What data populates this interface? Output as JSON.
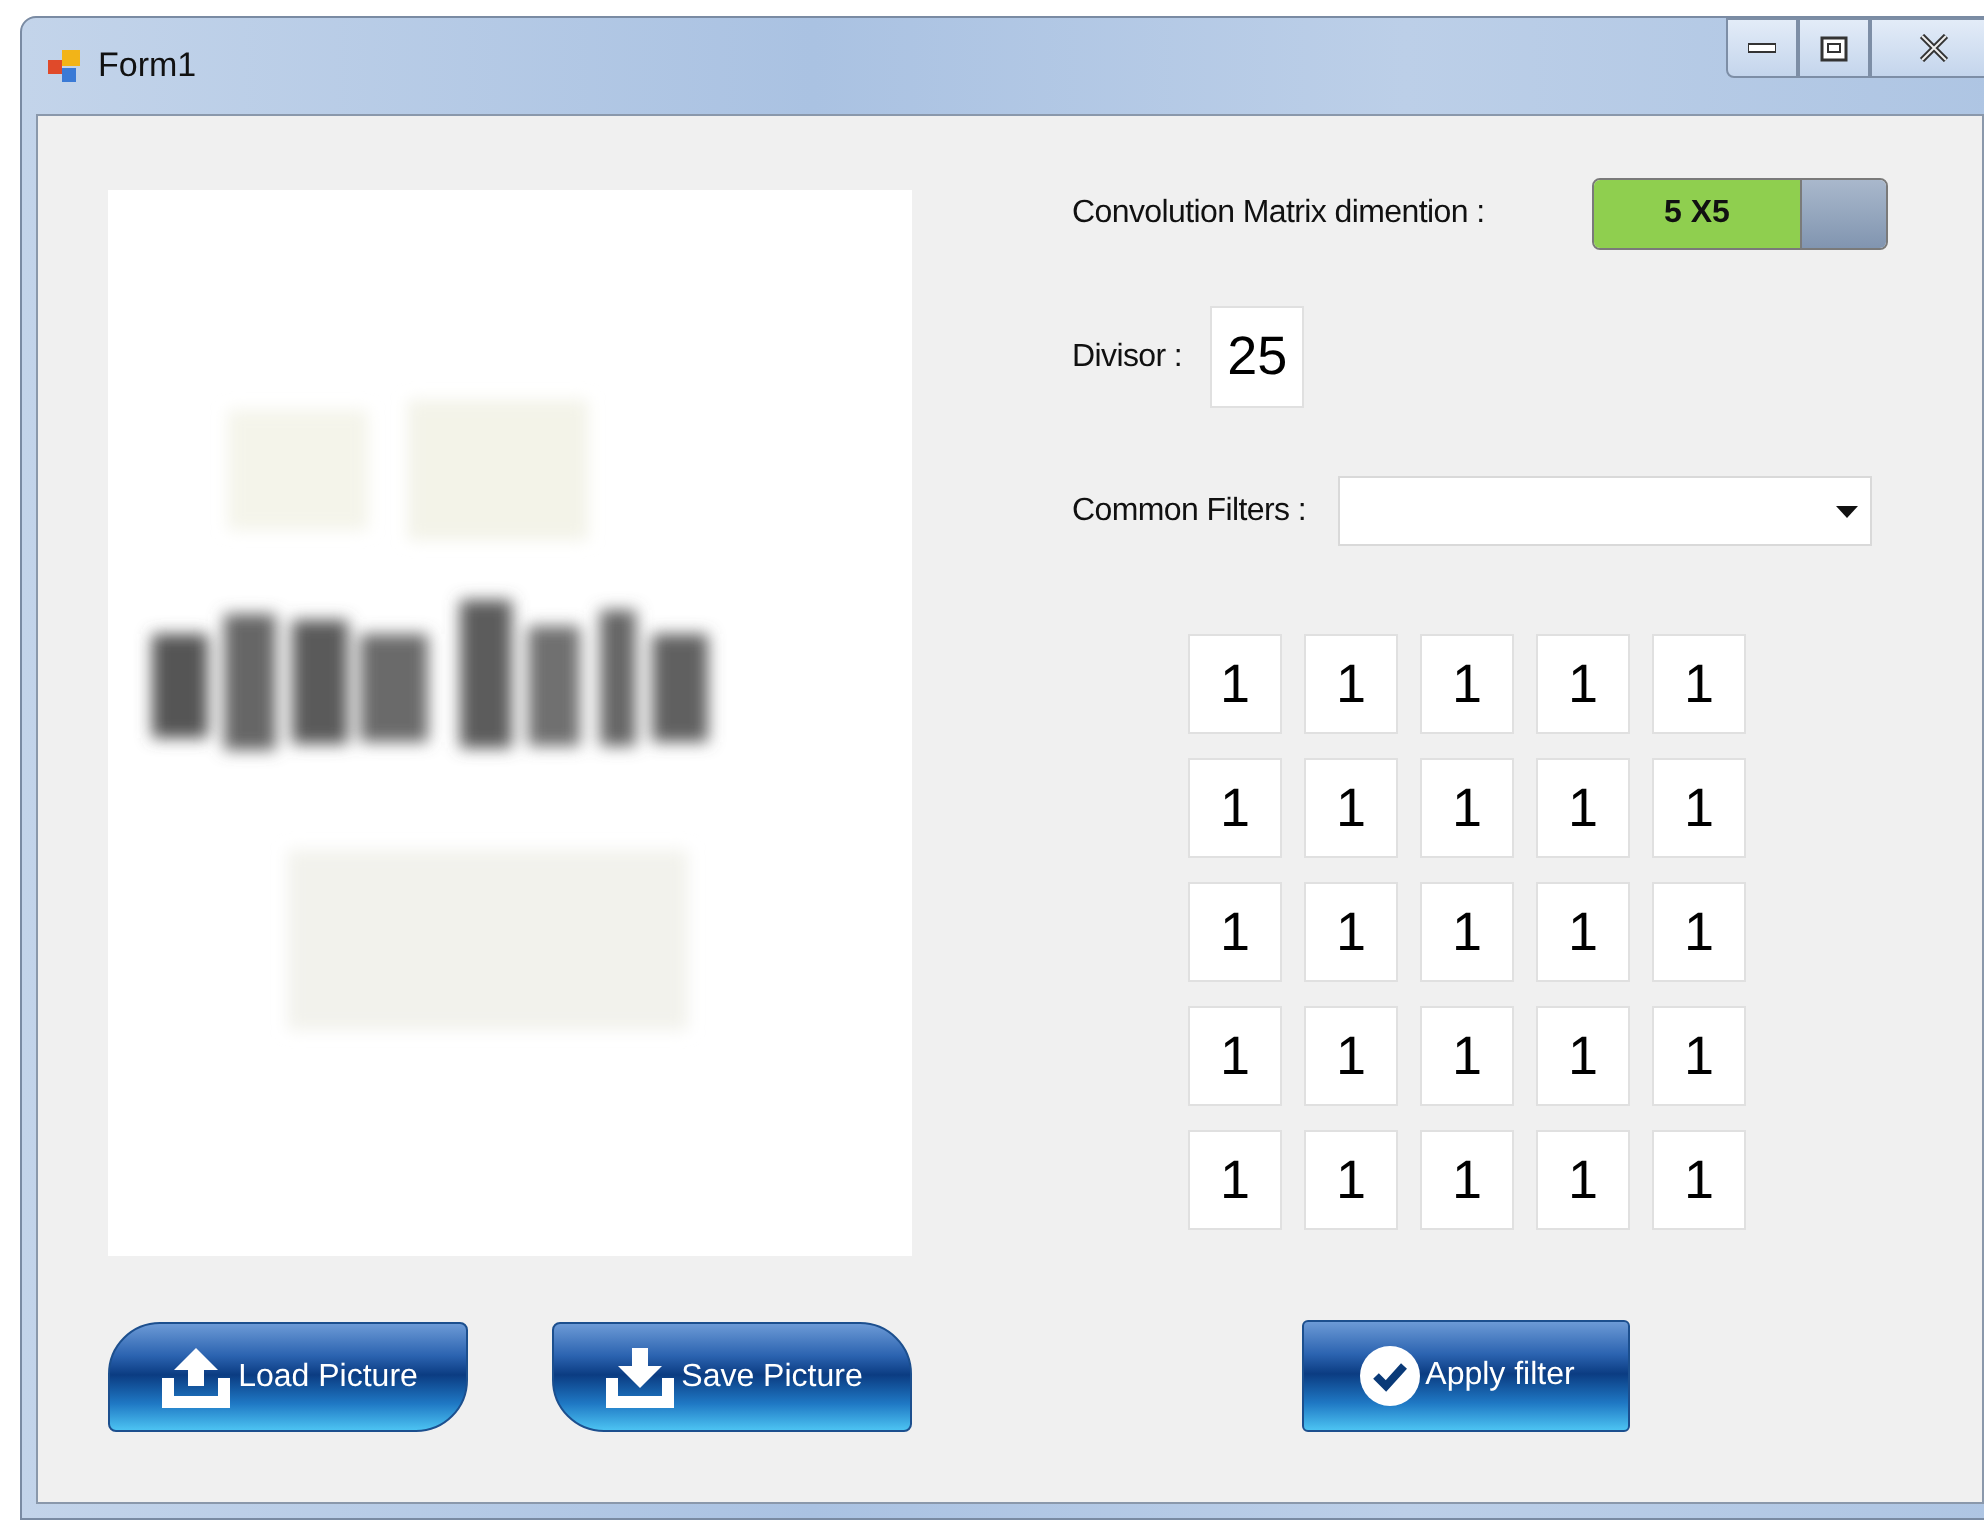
{
  "window": {
    "title": "Form1"
  },
  "file_buttons": [
    {
      "label": "Load Picture",
      "kind": "upload"
    },
    {
      "label": "Save Picture",
      "kind": "download"
    }
  ],
  "matrix_dimension": {
    "label": "Convolution Matrix dimention :",
    "toggle": {
      "text": "5 X5",
      "on": true
    }
  },
  "divisor": {
    "label": "Divisor :",
    "value": "25"
  },
  "common_filters": {
    "label": "Common Filters :"
  },
  "matrix": [
    [
      "1",
      "1",
      "1",
      "1",
      "1"
    ],
    [
      "1",
      "1",
      "1",
      "1",
      "1"
    ],
    [
      "1",
      "1",
      "1",
      "1",
      "1"
    ],
    [
      "1",
      "1",
      "1",
      "1",
      "1"
    ],
    [
      "1",
      "1",
      "1",
      "1",
      "1"
    ]
  ],
  "apply_button": {
    "label": "Apply filter"
  }
}
